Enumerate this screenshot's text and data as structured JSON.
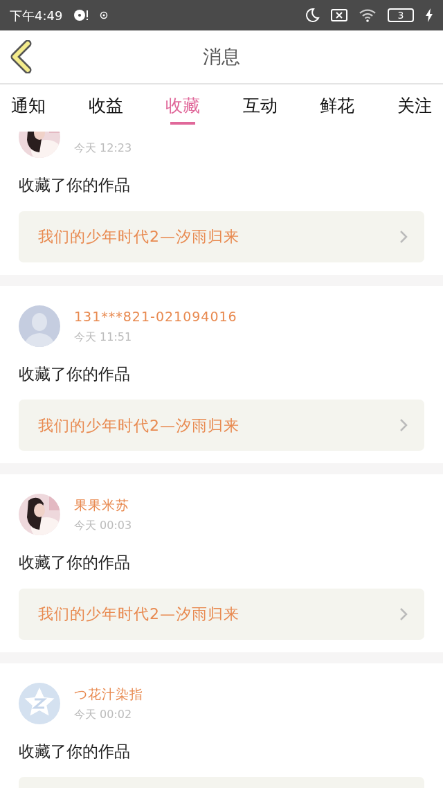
{
  "status_bar": {
    "time": "下午4:49",
    "battery": "3"
  },
  "header": {
    "title": "消息"
  },
  "tabs": [
    {
      "label": "通知",
      "selected": false
    },
    {
      "label": "收益",
      "selected": false
    },
    {
      "label": "收藏",
      "selected": true
    },
    {
      "label": "互动",
      "selected": false
    },
    {
      "label": "鲜花",
      "selected": false
    },
    {
      "label": "关注",
      "selected": false
    }
  ],
  "messages": [
    {
      "time": "今天 12:23",
      "text": "收藏了你的作品",
      "work": "我们的少年时代2—汐雨归来"
    },
    {
      "avatar": {
        "kind": "silhouette"
      },
      "user": "131***821-021094016",
      "time": "今天 11:51",
      "text": "收藏了你的作品",
      "work": "我们的少年时代2—汐雨归来"
    },
    {
      "user": "果果米苏",
      "time": "今天 00:03",
      "text": "收藏了你的作品",
      "work": "我们的少年时代2—汐雨归来"
    },
    {
      "avatar": {
        "kind": "star"
      },
      "user": "つ花汁染指",
      "time": "今天 00:02",
      "text": "收藏了你的作品"
    }
  ]
}
